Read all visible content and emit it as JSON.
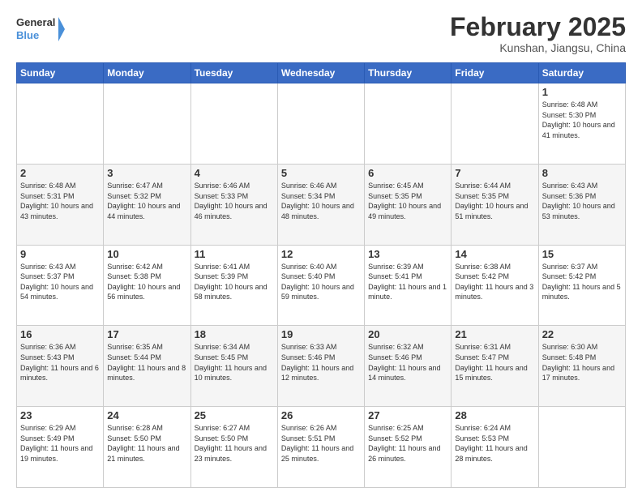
{
  "logo": {
    "line1": "General",
    "line2": "Blue"
  },
  "title": "February 2025",
  "subtitle": "Kunshan, Jiangsu, China",
  "days_of_week": [
    "Sunday",
    "Monday",
    "Tuesday",
    "Wednesday",
    "Thursday",
    "Friday",
    "Saturday"
  ],
  "weeks": [
    [
      {
        "day": "",
        "info": ""
      },
      {
        "day": "",
        "info": ""
      },
      {
        "day": "",
        "info": ""
      },
      {
        "day": "",
        "info": ""
      },
      {
        "day": "",
        "info": ""
      },
      {
        "day": "",
        "info": ""
      },
      {
        "day": "1",
        "info": "Sunrise: 6:48 AM\nSunset: 5:30 PM\nDaylight: 10 hours and 41 minutes."
      }
    ],
    [
      {
        "day": "2",
        "info": "Sunrise: 6:48 AM\nSunset: 5:31 PM\nDaylight: 10 hours and 43 minutes."
      },
      {
        "day": "3",
        "info": "Sunrise: 6:47 AM\nSunset: 5:32 PM\nDaylight: 10 hours and 44 minutes."
      },
      {
        "day": "4",
        "info": "Sunrise: 6:46 AM\nSunset: 5:33 PM\nDaylight: 10 hours and 46 minutes."
      },
      {
        "day": "5",
        "info": "Sunrise: 6:46 AM\nSunset: 5:34 PM\nDaylight: 10 hours and 48 minutes."
      },
      {
        "day": "6",
        "info": "Sunrise: 6:45 AM\nSunset: 5:35 PM\nDaylight: 10 hours and 49 minutes."
      },
      {
        "day": "7",
        "info": "Sunrise: 6:44 AM\nSunset: 5:35 PM\nDaylight: 10 hours and 51 minutes."
      },
      {
        "day": "8",
        "info": "Sunrise: 6:43 AM\nSunset: 5:36 PM\nDaylight: 10 hours and 53 minutes."
      }
    ],
    [
      {
        "day": "9",
        "info": "Sunrise: 6:43 AM\nSunset: 5:37 PM\nDaylight: 10 hours and 54 minutes."
      },
      {
        "day": "10",
        "info": "Sunrise: 6:42 AM\nSunset: 5:38 PM\nDaylight: 10 hours and 56 minutes."
      },
      {
        "day": "11",
        "info": "Sunrise: 6:41 AM\nSunset: 5:39 PM\nDaylight: 10 hours and 58 minutes."
      },
      {
        "day": "12",
        "info": "Sunrise: 6:40 AM\nSunset: 5:40 PM\nDaylight: 10 hours and 59 minutes."
      },
      {
        "day": "13",
        "info": "Sunrise: 6:39 AM\nSunset: 5:41 PM\nDaylight: 11 hours and 1 minute."
      },
      {
        "day": "14",
        "info": "Sunrise: 6:38 AM\nSunset: 5:42 PM\nDaylight: 11 hours and 3 minutes."
      },
      {
        "day": "15",
        "info": "Sunrise: 6:37 AM\nSunset: 5:42 PM\nDaylight: 11 hours and 5 minutes."
      }
    ],
    [
      {
        "day": "16",
        "info": "Sunrise: 6:36 AM\nSunset: 5:43 PM\nDaylight: 11 hours and 6 minutes."
      },
      {
        "day": "17",
        "info": "Sunrise: 6:35 AM\nSunset: 5:44 PM\nDaylight: 11 hours and 8 minutes."
      },
      {
        "day": "18",
        "info": "Sunrise: 6:34 AM\nSunset: 5:45 PM\nDaylight: 11 hours and 10 minutes."
      },
      {
        "day": "19",
        "info": "Sunrise: 6:33 AM\nSunset: 5:46 PM\nDaylight: 11 hours and 12 minutes."
      },
      {
        "day": "20",
        "info": "Sunrise: 6:32 AM\nSunset: 5:46 PM\nDaylight: 11 hours and 14 minutes."
      },
      {
        "day": "21",
        "info": "Sunrise: 6:31 AM\nSunset: 5:47 PM\nDaylight: 11 hours and 15 minutes."
      },
      {
        "day": "22",
        "info": "Sunrise: 6:30 AM\nSunset: 5:48 PM\nDaylight: 11 hours and 17 minutes."
      }
    ],
    [
      {
        "day": "23",
        "info": "Sunrise: 6:29 AM\nSunset: 5:49 PM\nDaylight: 11 hours and 19 minutes."
      },
      {
        "day": "24",
        "info": "Sunrise: 6:28 AM\nSunset: 5:50 PM\nDaylight: 11 hours and 21 minutes."
      },
      {
        "day": "25",
        "info": "Sunrise: 6:27 AM\nSunset: 5:50 PM\nDaylight: 11 hours and 23 minutes."
      },
      {
        "day": "26",
        "info": "Sunrise: 6:26 AM\nSunset: 5:51 PM\nDaylight: 11 hours and 25 minutes."
      },
      {
        "day": "27",
        "info": "Sunrise: 6:25 AM\nSunset: 5:52 PM\nDaylight: 11 hours and 26 minutes."
      },
      {
        "day": "28",
        "info": "Sunrise: 6:24 AM\nSunset: 5:53 PM\nDaylight: 11 hours and 28 minutes."
      },
      {
        "day": "",
        "info": ""
      }
    ]
  ]
}
